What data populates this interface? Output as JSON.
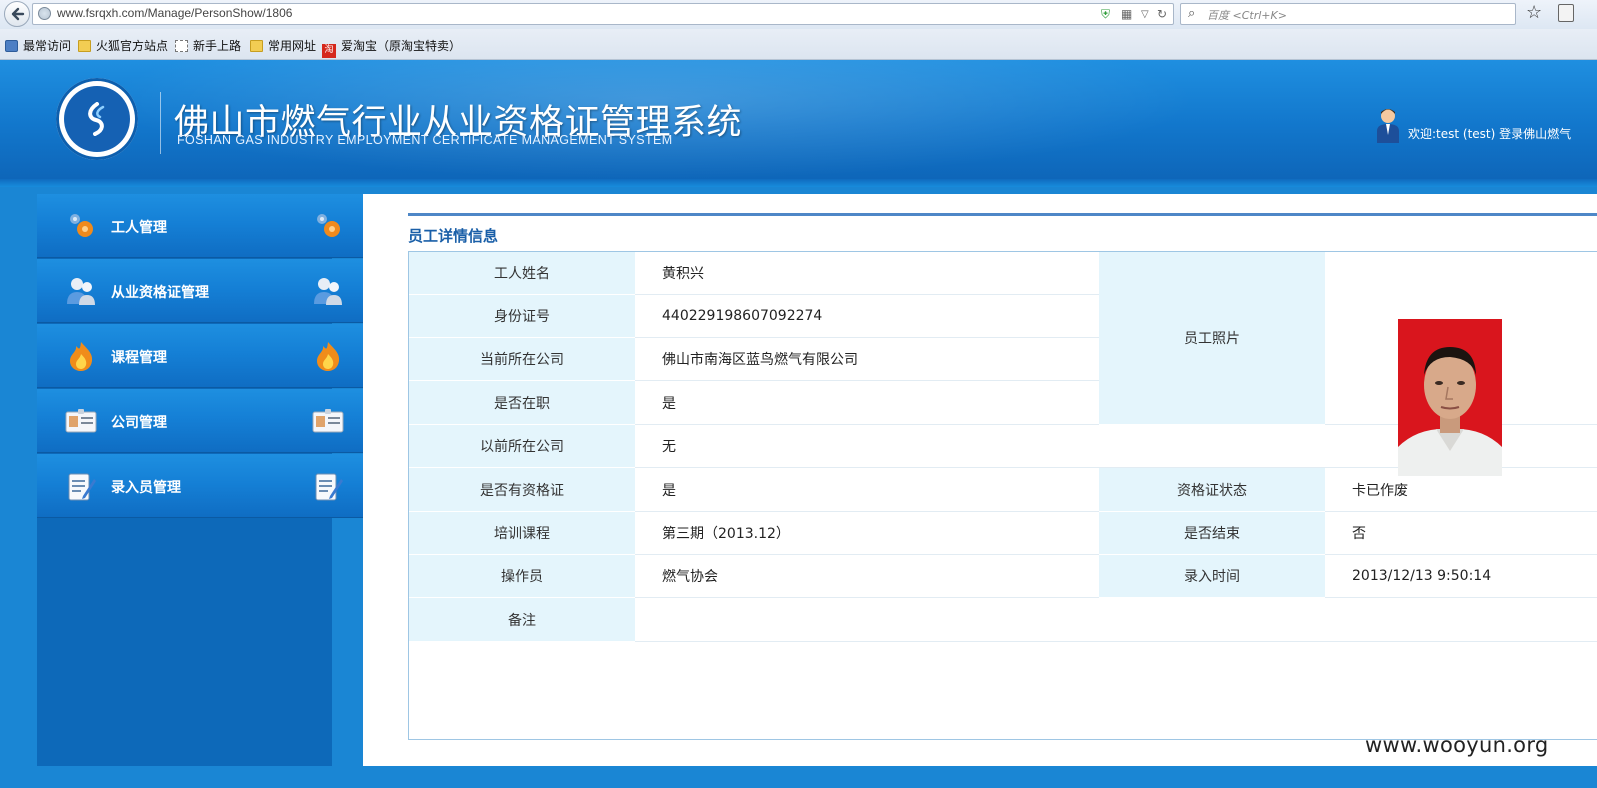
{
  "browser": {
    "url": "www.fsrqxh.com/Manage/PersonShow/1806",
    "search_placeholder": "百度 <Ctrl+K>",
    "bookmarks": [
      {
        "label": "最常访问",
        "icon": "most-visited-icon"
      },
      {
        "label": "火狐官方站点",
        "icon": "folder-icon"
      },
      {
        "label": "新手上路",
        "icon": "new-page-icon"
      },
      {
        "label": "常用网址",
        "icon": "folder-icon"
      },
      {
        "label": "爱淘宝（原淘宝特卖）",
        "icon": "taobao-icon"
      }
    ],
    "taobao_icon_char": "淘"
  },
  "header": {
    "title": "佛山市燃气行业从业资格证管理系统",
    "subtitle": "FOSHAN GAS INDUSTRY EMPLOYMENT CERTIFICATE MANAGEMENT SYSTEM",
    "welcome": "欢迎:test (test) 登录佛山燃气"
  },
  "sidebar": {
    "items": [
      {
        "label": "工人管理",
        "icon": "gears-icon"
      },
      {
        "label": "从业资格证管理",
        "icon": "users-icon"
      },
      {
        "label": "课程管理",
        "icon": "flame-icon"
      },
      {
        "label": "公司管理",
        "icon": "id-card-icon"
      },
      {
        "label": "录入员管理",
        "icon": "notepad-icon"
      }
    ]
  },
  "detail": {
    "section_title": "员工详情信息",
    "rows": {
      "name": {
        "label": "工人姓名",
        "value": "黄积兴"
      },
      "id_number": {
        "label": "身份证号",
        "value": "440229198607092274"
      },
      "current_company": {
        "label": "当前所在公司",
        "value": "佛山市南海区蓝鸟燃气有限公司"
      },
      "employed": {
        "label": "是否在职",
        "value": "是"
      },
      "previous_company": {
        "label": "以前所在公司",
        "value": "无"
      },
      "has_certificate": {
        "label": "是否有资格证",
        "value": "是"
      },
      "certificate_status": {
        "label": "资格证状态",
        "value": "卡已作废"
      },
      "training_course": {
        "label": "培训课程",
        "value": "第三期（2013.12）"
      },
      "finished": {
        "label": "是否结束",
        "value": "否"
      },
      "operator": {
        "label": "操作员",
        "value": "燃气协会"
      },
      "entry_time": {
        "label": "录入时间",
        "value": "2013/12/13 9:50:14"
      },
      "remark": {
        "label": "备注",
        "value": ""
      },
      "photo": {
        "label": "员工照片"
      }
    }
  },
  "watermark": "www.wooyun.org",
  "colors": {
    "header_blue": "#1277cc",
    "label_bg": "#e4f5fc",
    "section_title": "#1a5fa8",
    "photo_bg": "#d9151d"
  }
}
